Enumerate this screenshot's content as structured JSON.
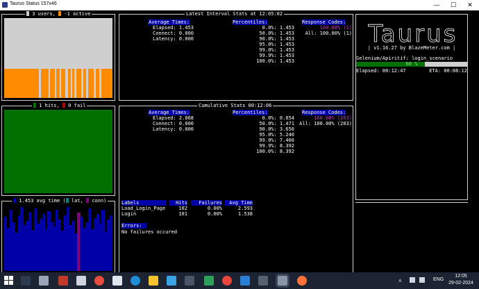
{
  "window": {
    "title": "Taurus Status 157x46",
    "controls": [
      "—",
      "☐",
      "✕"
    ]
  },
  "users_panel": {
    "users": "3 users,",
    "active": "-1 active",
    "user_color": "#cfcfcf",
    "active_color": "#ff8c00"
  },
  "hits_panel": {
    "hits": "1 hits,",
    "fail": "0 fail",
    "fill_color": "#007000"
  },
  "time_panel": {
    "avg": "1.453 avg time",
    "lat": "lat,",
    "conn": "conn)"
  },
  "latest": {
    "title": "Latest Interval Stats at 12:05:02",
    "avg_header": "Average Times:",
    "avg": [
      "Elapsed: 1.453",
      "Connect: 0.000",
      "Latency: 0.000"
    ],
    "pct_header": "Percentiles:",
    "pct": [
      "0.0%: 1.453",
      "50.0%: 1.453",
      "90.0%: 1.453",
      "95.0%: 1.453",
      "99.0%: 1.453",
      "99.9%: 1.453",
      "100.0%: 1.453"
    ],
    "rc_header": "Response Codes:",
    "rc": [
      "100.00% (1)",
      "All: 100.00% (1)"
    ]
  },
  "cumulative": {
    "title": "Cumulative Stats 00:12:06",
    "avg_header": "Average Times:",
    "avg": [
      "Elapsed: 2.068",
      "Connect: 0.000",
      "Latency: 0.000"
    ],
    "pct_header": "Percentiles:",
    "pct": [
      "0.0%: 0.654",
      "50.0%: 1.471",
      "90.0%: 3.650",
      "95.0%: 5.240",
      "99.0%: 7.460",
      "99.9%: 8.392",
      "100.0%: 8.392"
    ],
    "rc_header": "Response Codes:",
    "rc": [
      "100.00% (203)",
      "All: 100.00% (203)"
    ]
  },
  "labels_table": {
    "headers": [
      "Labels",
      "Hits",
      "Failures",
      "Avg Time"
    ],
    "rows": [
      [
        "Load_Login_Page",
        "102",
        "0.00%",
        "2.593"
      ],
      [
        "Login",
        "101",
        "0.00%",
        "1.538"
      ]
    ]
  },
  "errors": {
    "header": "Errors:",
    "text": "No failures occured"
  },
  "taurus": {
    "logo": "Taurus",
    "version": "| v1.16.27 by BlazeMeter.com |",
    "scenario": "Selenium/Apiritif: login_scenario",
    "progress_label": "60 %",
    "progress": 0.62,
    "elapsed": "Elapsed: 00:12:47",
    "eta": "ETA: 00:08:12"
  },
  "taskbar": {
    "lang": "ENG",
    "time": "12:05",
    "date": "29-02-2024"
  }
}
